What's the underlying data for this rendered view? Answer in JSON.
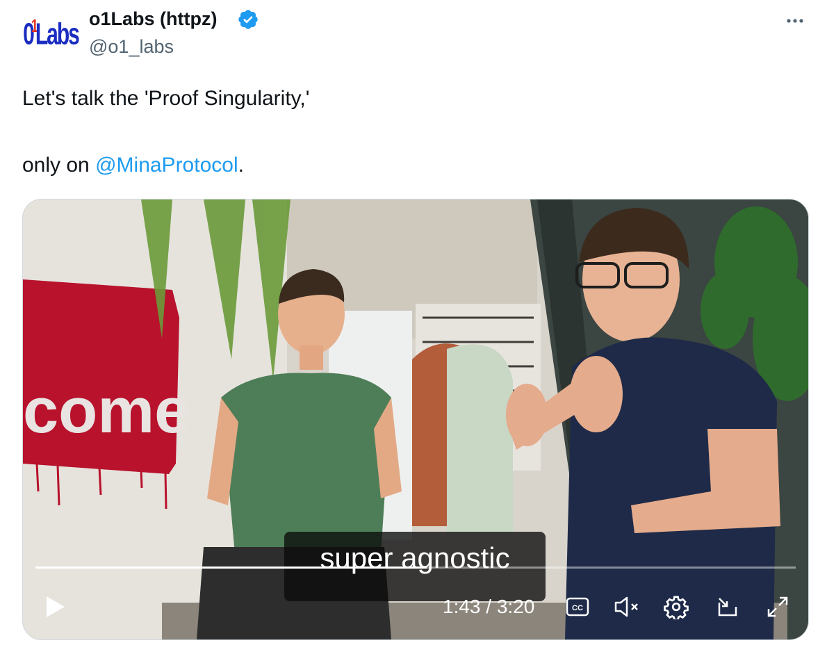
{
  "author": {
    "avatar_text": "o1abs",
    "display_name": "o1Labs (httpz)",
    "handle": "@o1_labs",
    "verified": true
  },
  "more_icon": "ellipsis-icon",
  "tweet": {
    "line1": "Let's talk the 'Proof Singularity,'",
    "line2_prefix": "only on ",
    "line2_mention": "@MinaProtocol",
    "line2_suffix": "."
  },
  "video": {
    "caption": "super agnostic",
    "current_time": "1:43",
    "time_separator": " / ",
    "duration": "3:20",
    "time_display": "1:43 / 3:20",
    "progress_fraction": 0.515,
    "background_graffiti_text": "come",
    "controls": {
      "play": "play-icon",
      "captions": "cc-icon",
      "mute": "volume-muted-icon",
      "settings": "gear-icon",
      "pip": "picture-in-picture-icon",
      "fullscreen": "fullscreen-icon"
    }
  },
  "colors": {
    "text": "#0f1419",
    "secondary": "#536471",
    "link": "#1d9bf0",
    "verified": "#1d9bf0"
  }
}
